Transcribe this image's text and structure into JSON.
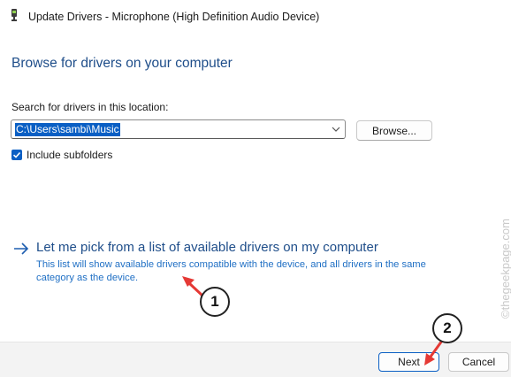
{
  "window": {
    "title": "Update Drivers - Microphone (High Definition Audio Device)"
  },
  "page": {
    "heading": "Browse for drivers on your computer"
  },
  "search": {
    "label": "Search for drivers in this location:",
    "value": "C:\\Users\\sambi\\Music",
    "browse_label": "Browse..."
  },
  "options": {
    "include_subfolders_label": "Include subfolders",
    "include_subfolders_checked": true
  },
  "pick_link": {
    "title": "Let me pick from a list of available drivers on my computer",
    "description": "This list will show available drivers compatible with the device, and all drivers in the same category as the device."
  },
  "footer": {
    "next_label": "Next",
    "cancel_label": "Cancel"
  },
  "annotations": {
    "step1": "1",
    "step2": "2"
  },
  "watermark": "©thegeekpage.com",
  "colors": {
    "accent": "#0a5fc4",
    "heading": "#1f4e8a",
    "link_desc": "#1f6fc4",
    "arrow_annotation": "#e53935"
  }
}
